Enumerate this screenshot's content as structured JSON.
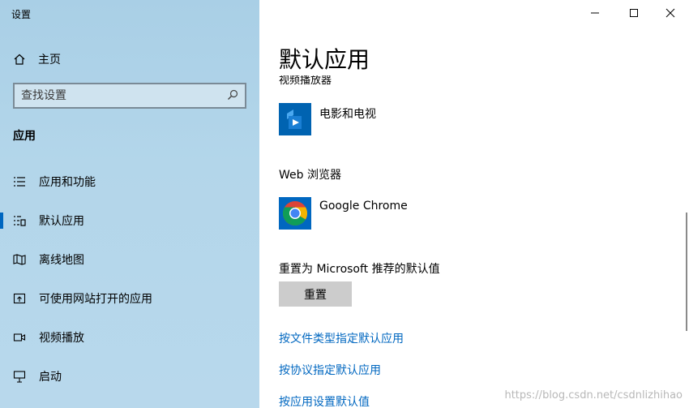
{
  "window": {
    "title": "设置"
  },
  "sidebar": {
    "home_label": "主页",
    "search_placeholder": "查找设置",
    "section_title": "应用",
    "items": [
      {
        "label": "应用和功能",
        "icon": "list-icon"
      },
      {
        "label": "默认应用",
        "icon": "default-apps-icon"
      },
      {
        "label": "离线地图",
        "icon": "map-icon"
      },
      {
        "label": "可使用网站打开的应用",
        "icon": "open-web-icon"
      },
      {
        "label": "视频播放",
        "icon": "video-icon"
      },
      {
        "label": "启动",
        "icon": "startup-icon"
      }
    ],
    "active_index": 1
  },
  "content": {
    "title": "默认应用",
    "clipped_label": "视频播放器",
    "video_player": {
      "app_name": "电影和电视",
      "icon": "movies-tv-icon"
    },
    "browser": {
      "label": "Web 浏览器",
      "app_name": "Google Chrome",
      "icon": "chrome-icon"
    },
    "reset": {
      "label": "重置为 Microsoft 推荐的默认值",
      "button": "重置"
    },
    "links": [
      "按文件类型指定默认应用",
      "按协议指定默认应用",
      "按应用设置默认值"
    ]
  },
  "watermark": "https://blog.csdn.net/csdnlizhihao",
  "colors": {
    "accent": "#0067c0",
    "sidebar_bg": "#b3d6ea",
    "button_bg": "#cccccc"
  }
}
